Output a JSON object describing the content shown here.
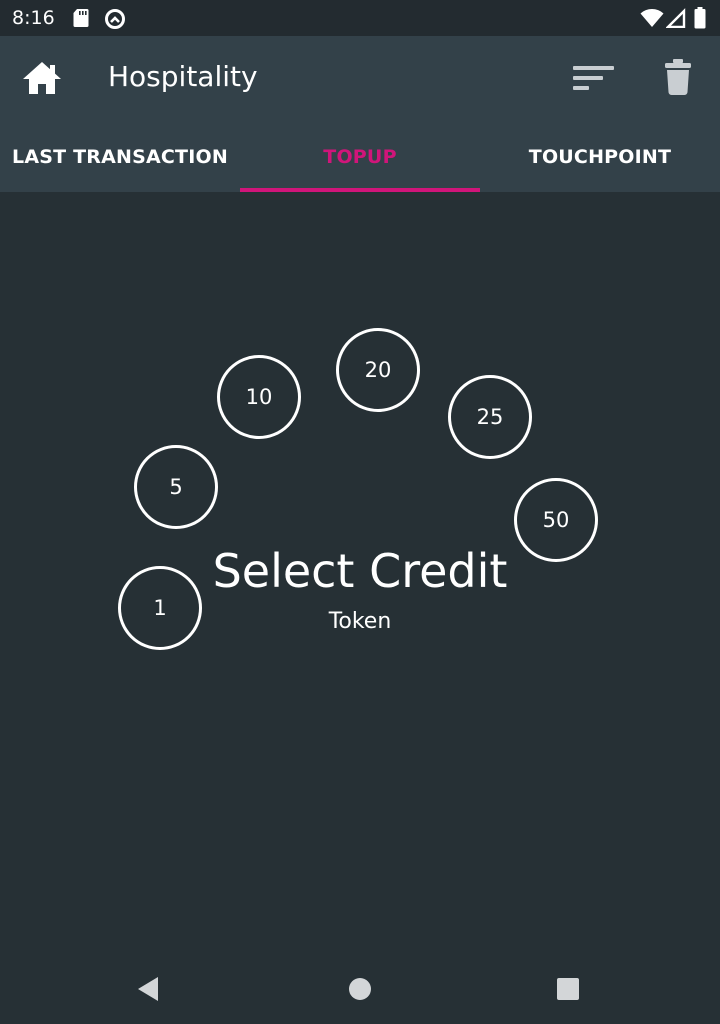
{
  "status_bar": {
    "time": "8:16",
    "icons_left": [
      "sd-card-icon",
      "data-saver-icon"
    ],
    "icons_right": [
      "wifi-icon",
      "signal-icon",
      "battery-icon"
    ]
  },
  "app_bar": {
    "title": "Hospitality",
    "icons": [
      "home-icon",
      "sort-icon",
      "trash-icon"
    ]
  },
  "tabs": [
    {
      "label": "LAST TRANSACTION",
      "active": false
    },
    {
      "label": "TOPUP",
      "active": true
    },
    {
      "label": "TOUCHPOINT",
      "active": false
    }
  ],
  "colors": {
    "background": "#263035",
    "app_bar": "#334149",
    "accent": "#d0157a"
  },
  "main": {
    "title": "Select Credit",
    "subtitle": "Token",
    "credits": [
      "1",
      "5",
      "10",
      "20",
      "25",
      "50"
    ]
  },
  "nav_bar": {
    "icons": [
      "back-icon",
      "home-circle-icon",
      "recents-icon"
    ]
  }
}
